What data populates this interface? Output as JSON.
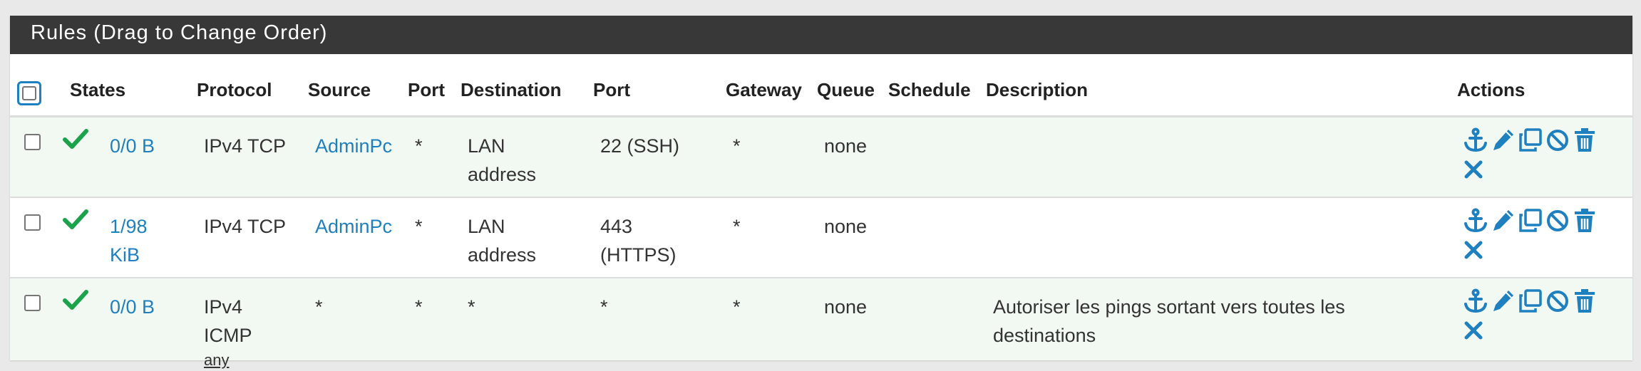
{
  "panel": {
    "title": "Rules (Drag to Change Order)"
  },
  "columns": {
    "states": "States",
    "protocol": "Protocol",
    "source": "Source",
    "port": "Port",
    "destination": "Destination",
    "dest_port": "Port",
    "gateway": "Gateway",
    "queue": "Queue",
    "schedule": "Schedule",
    "description": "Description",
    "actions": "Actions"
  },
  "rules": [
    {
      "enabled": true,
      "states": "0/0 B",
      "protocol": "IPv4 TCP",
      "protocol_sub": "",
      "source": "AdminPc",
      "port": "*",
      "destination": "LAN address",
      "dest_port": "22 (SSH)",
      "gateway": "*",
      "queue": "none",
      "schedule": "",
      "description": ""
    },
    {
      "enabled": true,
      "states": "1/98 KiB",
      "protocol": "IPv4 TCP",
      "protocol_sub": "",
      "source": "AdminPc",
      "port": "*",
      "destination": "LAN address",
      "dest_port": "443 (HTTPS)",
      "gateway": "*",
      "queue": "none",
      "schedule": "",
      "description": ""
    },
    {
      "enabled": true,
      "states": "0/0 B",
      "protocol": "IPv4 ICMP",
      "protocol_sub": "any",
      "source": "*",
      "port": "*",
      "destination": "*",
      "dest_port": "*",
      "gateway": "*",
      "queue": "none",
      "schedule": "",
      "description": "Autoriser les pings sortant vers toutes les destinations"
    }
  ],
  "icons": [
    "check-icon",
    "anchor-icon",
    "pencil-icon",
    "copy-icon",
    "disable-icon",
    "trash-icon",
    "delete-x-icon"
  ],
  "colors": {
    "header_bg": "#383838",
    "link": "#1f80c0",
    "check": "#1aa34a",
    "row_alt": "#f2f8f2"
  }
}
